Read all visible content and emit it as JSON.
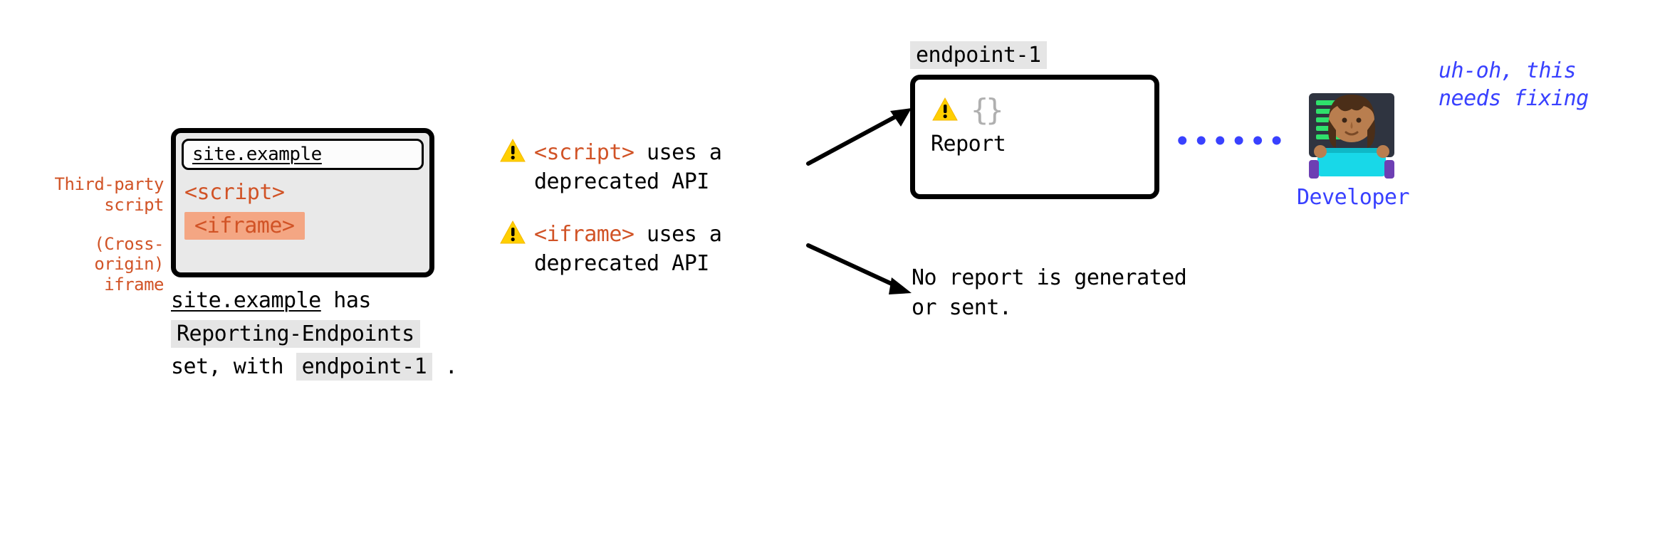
{
  "leftLabels": {
    "script": "Third-party script",
    "iframe": "(Cross-origin) iframe"
  },
  "browser": {
    "url": "site.example",
    "scriptTag": "<script>",
    "iframeTag": "<iframe>"
  },
  "caption": {
    "site": "site.example",
    "text1": " has ",
    "header": "Reporting-Endpoints",
    "text2": "set, with ",
    "endpoint": "endpoint-1",
    "text3": " ."
  },
  "msg1": {
    "tag": "<script>",
    "rest": " uses a deprecated API"
  },
  "msg2": {
    "tag": "<iframe>",
    "rest": " uses a deprecated API"
  },
  "endpoint": {
    "label": "endpoint-1",
    "braces": "{}",
    "report": "Report"
  },
  "noReport": "No report is generated or sent.",
  "developer": {
    "label": "Developer",
    "quote": "uh-oh, this needs fixing"
  }
}
